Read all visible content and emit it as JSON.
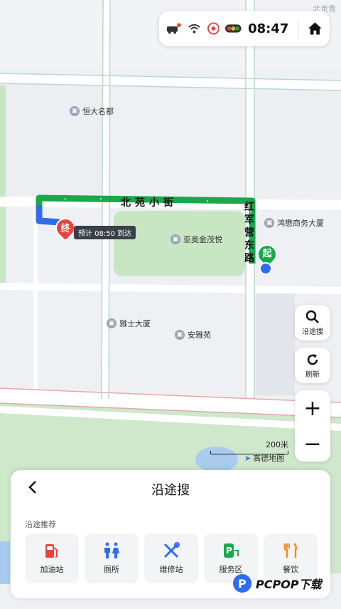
{
  "status_bar": {
    "time": "08:47",
    "icons": [
      "car-status-icon",
      "wifi-icon",
      "cast-icon",
      "traffic-light-icon"
    ],
    "home_icon": "home-icon"
  },
  "map": {
    "corner_label": "北京青",
    "pois": [
      {
        "name": "恒大名都"
      },
      {
        "name": "鸿懋商务大厦"
      },
      {
        "name": "亚奥金茂悦"
      },
      {
        "name": "雅士大厦"
      },
      {
        "name": "安雅苑"
      }
    ],
    "roads": {
      "horizontal": "北苑小街",
      "vertical": "红军营东路"
    },
    "start_marker": "起",
    "end_marker": "终",
    "eta": "预计 08:50 到达",
    "scale": "200米",
    "attribution": "高德地图",
    "route_color": "#1aa84a",
    "route_blue": "#2f6cf0"
  },
  "side_controls": {
    "search_along": "沿途搜",
    "refresh": "刷新",
    "zoom_in": "+",
    "zoom_out": "−"
  },
  "panel": {
    "title": "沿途搜",
    "subtitle": "沿途推荐",
    "categories": [
      {
        "label": "加油站",
        "icon": "gas-station-icon",
        "color": "#e8453c"
      },
      {
        "label": "厕所",
        "icon": "restroom-icon",
        "color": "#2f6cf0"
      },
      {
        "label": "维修站",
        "icon": "repair-tools-icon",
        "color": "#2f6cf0"
      },
      {
        "label": "服务区",
        "icon": "service-area-icon",
        "color": "#1aa84a"
      },
      {
        "label": "餐饮",
        "icon": "fork-knife-icon",
        "color": "#f08c1a"
      }
    ]
  },
  "watermark": "PCPOP下载"
}
